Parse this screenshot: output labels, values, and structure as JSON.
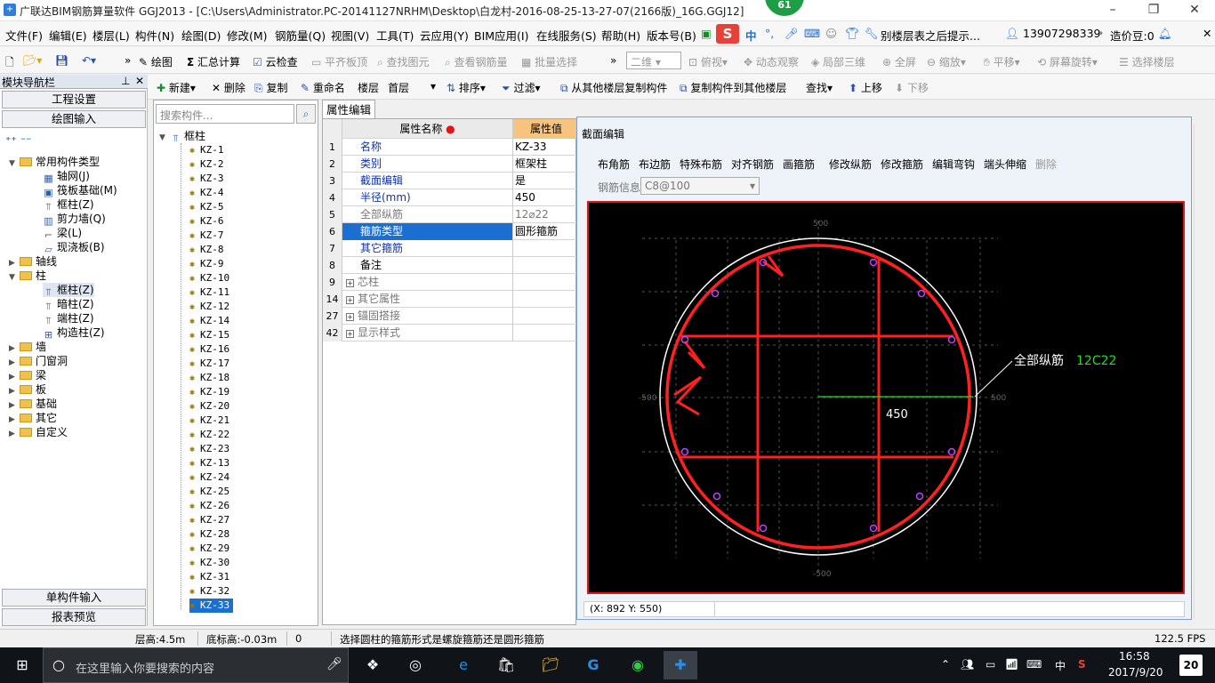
{
  "window": {
    "title": "广联达BIM钢筋算量软件 GGJ2013 - [C:\\Users\\Administrator.PC-20141127NRHM\\Desktop\\白龙村-2016-08-25-13-27-07(2166版)_16G.GGJ12]",
    "badge": "61"
  },
  "menu": {
    "items": [
      "文件(F)",
      "编辑(E)",
      "楼层(L)",
      "构件(N)",
      "绘图(D)",
      "修改(M)",
      "钢筋量(Q)",
      "视图(V)",
      "工具(T)",
      "云应用(Y)",
      "BIM应用(I)",
      "在线服务(S)",
      "帮助(H)",
      "版本号(B)"
    ],
    "ime_cn": "中",
    "notice": "别楼层表之后提示...",
    "phone": "13907298339",
    "beans": "造价豆:0"
  },
  "toolbar1": {
    "draw": "绘图",
    "sum_calc": "汇总计算",
    "cloud_check": "云检查",
    "flat_top": "平齐板顶",
    "find_elem": "查找图元",
    "view_rebar": "查看钢筋量",
    "batch_select": "批量选择",
    "view_mode": "二维",
    "top_view": "俯视",
    "dynamic_view": "动态观察",
    "local_3d": "局部三维",
    "fullscreen": "全屏",
    "zoom": "缩放",
    "pan": "平移",
    "rotate": "屏幕旋转",
    "select_floor": "选择楼层"
  },
  "toolbar2": {
    "new": "新建",
    "delete": "删除",
    "copy": "复制",
    "rename": "重命名",
    "floor_label": "楼层",
    "floor_value": "首层",
    "sort": "排序",
    "filter": "过滤",
    "copy_from": "从其他楼层复制构件",
    "copy_to": "复制构件到其他楼层",
    "find": "查找",
    "move_up": "上移",
    "move_down": "下移"
  },
  "nav": {
    "header": "模块导航栏",
    "project_settings": "工程设置",
    "drawing_input": "绘图输入",
    "single_input": "单构件输入",
    "report_preview": "报表预览",
    "tree": {
      "common": "常用构件类型",
      "common_children": [
        "轴网(J)",
        "筏板基础(M)",
        "框柱(Z)",
        "剪力墙(Q)",
        "梁(L)",
        "现浇板(B)"
      ],
      "axis": "轴线",
      "column": "柱",
      "column_children": [
        "框柱(Z)",
        "暗柱(Z)",
        "端柱(Z)",
        "构造柱(Z)"
      ],
      "others": [
        "墙",
        "门窗洞",
        "梁",
        "板",
        "基础",
        "其它",
        "自定义"
      ]
    }
  },
  "components": {
    "search_placeholder": "搜索构件...",
    "root": "框柱",
    "items": [
      "KZ-1",
      "KZ-2",
      "KZ-3",
      "KZ-4",
      "KZ-5",
      "KZ-6",
      "KZ-7",
      "KZ-8",
      "KZ-9",
      "KZ-10",
      "KZ-11",
      "KZ-12",
      "KZ-14",
      "KZ-15",
      "KZ-16",
      "KZ-17",
      "KZ-18",
      "KZ-19",
      "KZ-20",
      "KZ-21",
      "KZ-22",
      "KZ-23",
      "KZ-13",
      "KZ-24",
      "KZ-25",
      "KZ-26",
      "KZ-27",
      "KZ-28",
      "KZ-29",
      "KZ-30",
      "KZ-31",
      "KZ-32",
      "KZ-33"
    ],
    "selected": "KZ-33"
  },
  "properties": {
    "tab": "属性编辑",
    "col_name": "属性名称",
    "col_value": "属性值",
    "rows": [
      {
        "no": "1",
        "name": "名称",
        "value": "KZ-33",
        "style": "blue"
      },
      {
        "no": "2",
        "name": "类别",
        "value": "框架柱",
        "style": "blue"
      },
      {
        "no": "3",
        "name": "截面编辑",
        "value": "是",
        "style": "blue"
      },
      {
        "no": "4",
        "name": "半径(mm)",
        "value": "450",
        "style": "blue"
      },
      {
        "no": "5",
        "name": "全部纵筋",
        "value": "12⌀22",
        "style": "gray"
      },
      {
        "no": "6",
        "name": "箍筋类型",
        "value": "圆形箍筋",
        "style": "sel"
      },
      {
        "no": "7",
        "name": "其它箍筋",
        "value": "",
        "style": "blue"
      },
      {
        "no": "8",
        "name": "备注",
        "value": "",
        "style": ""
      },
      {
        "no": "9",
        "name": "芯柱",
        "value": "",
        "style": "group"
      },
      {
        "no": "14",
        "name": "其它属性",
        "value": "",
        "style": "group"
      },
      {
        "no": "27",
        "name": "锚固搭接",
        "value": "",
        "style": "group"
      },
      {
        "no": "42",
        "name": "显示样式",
        "value": "",
        "style": "group"
      }
    ]
  },
  "section_editor": {
    "title": "截面编辑",
    "tools": [
      "布角筋",
      "布边筋",
      "特殊布筋",
      "对齐钢筋",
      "画箍筋",
      "修改纵筋",
      "修改箍筋",
      "编辑弯钩",
      "端头伸缩",
      "删除"
    ],
    "rebar_info_label": "钢筋信息",
    "rebar_info_value": "C8@100",
    "radius_label": "450",
    "longitudinal_label": "全部纵筋",
    "longitudinal_value": "12C22",
    "axis_pos": "500",
    "axis_neg": "-500",
    "coords": "(X: 892 Y: 550)",
    "colors": {
      "stirrup": "#ff2020",
      "outline": "#ffffff",
      "rebar": "#c040ff",
      "dim": "#22dd22"
    }
  },
  "status": {
    "floor_height": "层高:4.5m",
    "base_elev": "底标高:-0.03m",
    "count": "0",
    "hint": "选择圆柱的箍筋形式是螺旋箍筋还是圆形箍筋",
    "fps": "122.5 FPS"
  },
  "taskbar": {
    "search": "在这里输入你要搜索的内容",
    "ime": "中",
    "time": "16:58",
    "date": "2017/9/20",
    "notify": "20"
  }
}
